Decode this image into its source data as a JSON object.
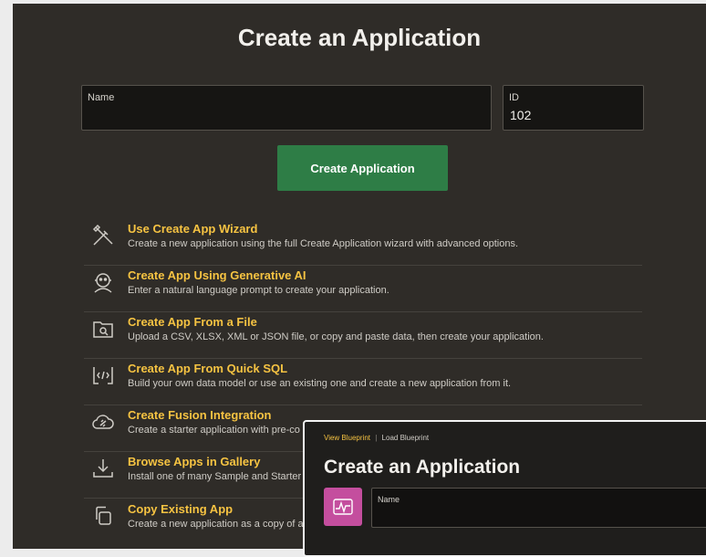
{
  "main": {
    "title": "Create an Application",
    "name_field": {
      "label": "Name",
      "value": ""
    },
    "id_field": {
      "label": "ID",
      "value": "102"
    },
    "create_button": "Create Application",
    "options": [
      {
        "title": "Use Create App Wizard",
        "desc": "Create a new application using the full Create Application wizard with advanced options.",
        "icon": "wizard-icon"
      },
      {
        "title": "Create App Using Generative AI",
        "desc": "Enter a natural language prompt to create your application.",
        "icon": "ai-assistant-icon"
      },
      {
        "title": "Create App From a File",
        "desc": "Upload a CSV, XLSX, XML or JSON file, or copy and paste data, then create your application.",
        "icon": "file-search-icon"
      },
      {
        "title": "Create App From Quick SQL",
        "desc": "Build your own data model or use an existing one and create a new application from it.",
        "icon": "code-icon"
      },
      {
        "title": "Create Fusion Integration",
        "desc": "Create a starter application with pre-co",
        "icon": "cloud-link-icon"
      },
      {
        "title": "Browse Apps in Gallery",
        "desc": "Install one of many Sample and Starter",
        "icon": "download-icon"
      },
      {
        "title": "Copy Existing App",
        "desc": "Create a new application as a copy of a",
        "icon": "copy-icon"
      }
    ]
  },
  "overlay": {
    "link_view": "View Blueprint",
    "link_separator": "|",
    "link_load": "Load Blueprint",
    "title": "Create an Application",
    "app_icon": "app-chart-icon",
    "name_field": {
      "label": "Name"
    }
  },
  "colors": {
    "panel_bg": "#2f2c28",
    "accent_yellow": "#f6c342",
    "button_green": "#2e7d46",
    "app_icon_pink": "#c44e9e"
  }
}
